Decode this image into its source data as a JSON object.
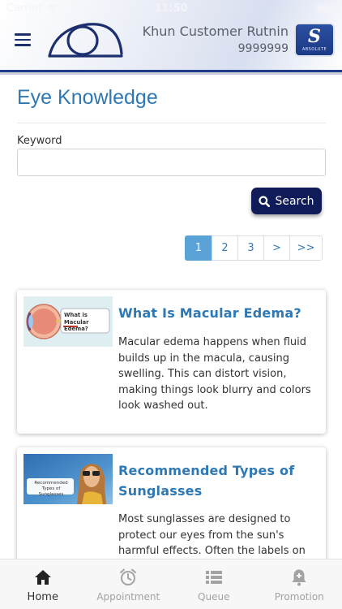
{
  "status_bar": {
    "carrier": "Carrier",
    "time": "11:50"
  },
  "header": {
    "user_name": "Khun Customer Rutnin",
    "user_id": "9999999",
    "brand_badge_letter": "S",
    "brand_badge_text": "ABSOLUTE",
    "accent_color": "#1f3b8a"
  },
  "page": {
    "title": "Eye Knowledge",
    "keyword_label": "Keyword",
    "keyword_value": "",
    "keyword_placeholder": "",
    "search_label": "Search"
  },
  "pagination": {
    "pages": [
      "1",
      "2",
      "3",
      ">",
      ">>"
    ],
    "active_page": "1"
  },
  "articles": [
    {
      "thumbnail_caption": "What is Macular Edema?",
      "title": "What Is Macular Edema?",
      "description": "Macular edema happens when fluid builds up in the macula, causing swelling. This can distort vision, making things look blurry and colors look washed out."
    },
    {
      "thumbnail_caption": "Recommended Types of Sunglasses",
      "title": "Recommended Types of Sunglasses",
      "description": "Most sunglasses are designed to protect our eyes from the sun's harmful effects. Often the labels on"
    }
  ],
  "tabbar": {
    "tabs": [
      {
        "label": "Home",
        "icon": "home-icon",
        "active": true
      },
      {
        "label": "Appointment",
        "icon": "alarm-clock-icon",
        "active": false
      },
      {
        "label": "Queue",
        "icon": "list-icon",
        "active": false
      },
      {
        "label": "Promotion",
        "icon": "bell-plus-icon",
        "active": false
      }
    ],
    "active_color": "#222222",
    "inactive_color": "#a3a3a3"
  }
}
